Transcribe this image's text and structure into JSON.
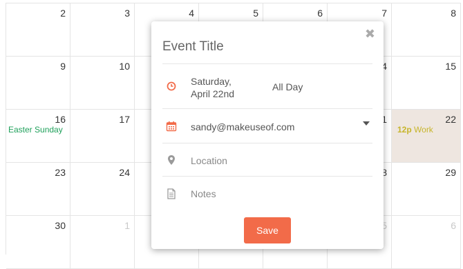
{
  "calendar": {
    "rows": [
      [
        "2",
        "3",
        "4",
        "5",
        "6",
        "7",
        "8"
      ],
      [
        "9",
        "10",
        "",
        "",
        "",
        "14",
        "15"
      ],
      [
        "16",
        "17",
        "",
        "",
        "",
        "21",
        "22"
      ],
      [
        "23",
        "24",
        "",
        "",
        "",
        "28",
        "29"
      ],
      [
        "30",
        "1",
        "",
        "",
        "",
        "5",
        "6"
      ]
    ],
    "events": {
      "easter": "Easter Sunday",
      "work_time": "12p",
      "work_label": "Work"
    }
  },
  "modal": {
    "title_placeholder": "Event Title",
    "close_glyph": "✖",
    "date_line1": "Saturday,",
    "date_line2": "April 22nd",
    "all_day": "All Day",
    "calendar_account": "sandy@makeuseof.com",
    "location_placeholder": "Location",
    "notes_placeholder": "Notes",
    "save_label": "Save"
  },
  "colors": {
    "accent": "#f26b49",
    "easter_green": "#1ea05a",
    "work_yellow": "#c7b52a",
    "highlight_cell": "#eee6e0"
  },
  "icons": [
    "clock-icon",
    "calendar-icon",
    "location-pin-icon",
    "document-icon",
    "close-icon",
    "chevron-down-icon"
  ]
}
